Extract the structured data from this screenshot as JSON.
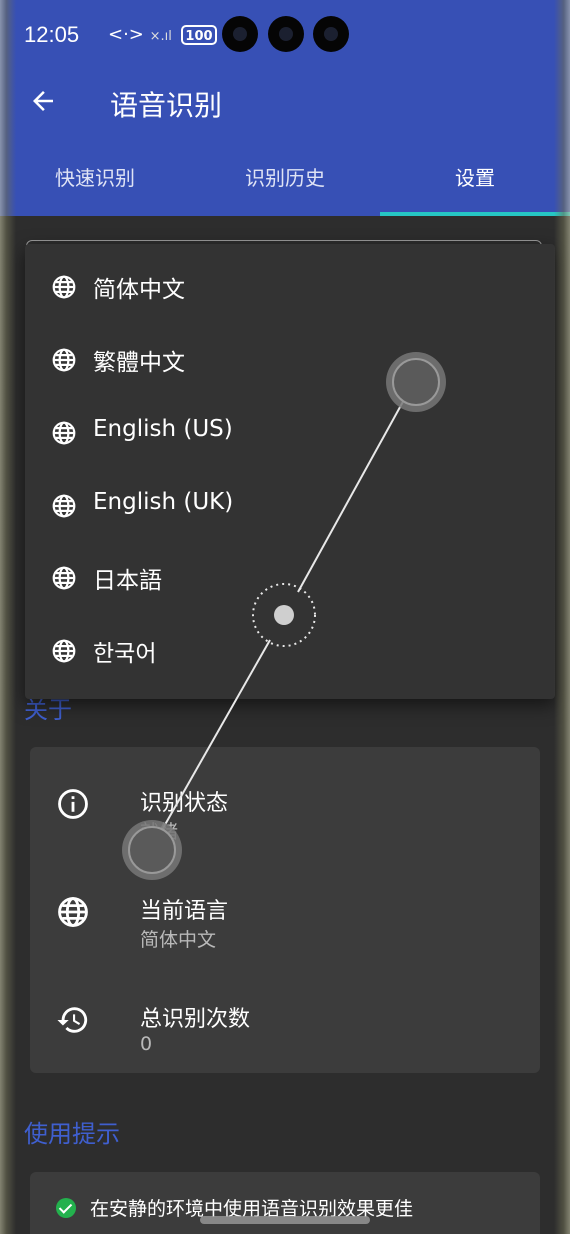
{
  "status_bar": {
    "time": "12:05",
    "icons": "<·>",
    "signal": "×.ıl",
    "battery": "100"
  },
  "app_bar": {
    "title": "语音识别"
  },
  "tabs": [
    {
      "label": "快速识别",
      "active": false
    },
    {
      "label": "识别历史",
      "active": false
    },
    {
      "label": "设置",
      "active": true
    }
  ],
  "language_menu": {
    "options": [
      {
        "label": "简体中文",
        "icon": "globe-icon"
      },
      {
        "label": "繁體中文",
        "icon": "globe-icon"
      },
      {
        "label": "English (US)",
        "icon": "globe-icon"
      },
      {
        "label": "English (UK)",
        "icon": "globe-icon"
      },
      {
        "label": "日本語",
        "icon": "globe-icon"
      },
      {
        "label": "한국어",
        "icon": "globe-icon"
      }
    ]
  },
  "about": {
    "heading": "关于",
    "items": [
      {
        "title": "识别状态",
        "value": "就绪",
        "icon": "info-icon"
      },
      {
        "title": "当前语言",
        "value": "简体中文",
        "icon": "globe-icon"
      },
      {
        "title": "总识别次数",
        "value": "0",
        "icon": "history-icon"
      }
    ]
  },
  "tips": {
    "heading": "使用提示",
    "items": [
      {
        "text": "在安静的环境中使用语音识别效果更佳",
        "icon": "check-circle-icon"
      }
    ]
  },
  "colors": {
    "appbar": "#3750b5",
    "accent_indicator": "#26c6c4",
    "section_heading": "#3f5fcf",
    "success": "#23b14d"
  }
}
